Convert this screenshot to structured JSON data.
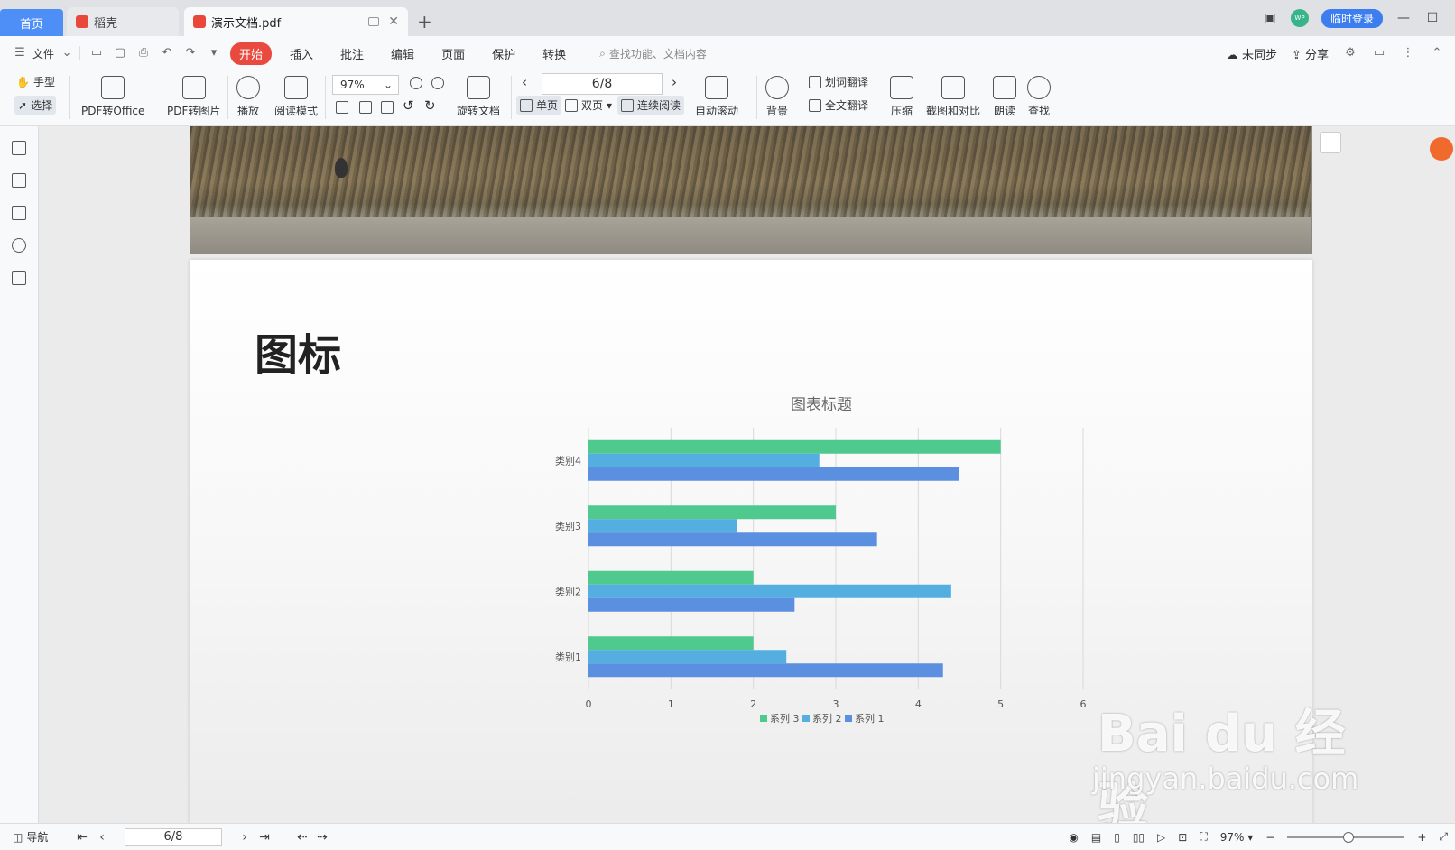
{
  "tabs": {
    "home": "首页",
    "daoke": "稻壳",
    "doc": "演示文档.pdf",
    "add": "+"
  },
  "titlebar": {
    "login": "临时登录",
    "avatar_text": "WP"
  },
  "menu": {
    "file": "文件",
    "tabs": [
      "开始",
      "插入",
      "批注",
      "编辑",
      "页面",
      "保护",
      "转换"
    ],
    "search_placeholder": "查找功能、文档内容",
    "sync": "未同步",
    "share": "分享"
  },
  "toolbar": {
    "hand": "手型",
    "select": "选择",
    "pdf_to_office": "PDF转Office",
    "pdf_to_image": "PDF转图片",
    "play": "播放",
    "read_mode": "阅读模式",
    "zoom": "97%",
    "rotate_doc": "旋转文档",
    "page_indicator": "6/8",
    "single_page": "单页",
    "double_page": "双页",
    "continuous": "连续阅读",
    "auto_scroll": "自动滚动",
    "background": "背景",
    "word_translate": "划词翻译",
    "full_translate": "全文翻译",
    "compress": "压缩",
    "screenshot_compare": "截图和对比",
    "read_aloud": "朗读",
    "find": "查找"
  },
  "page": {
    "heading": "图标"
  },
  "chart_data": {
    "type": "bar",
    "orientation": "horizontal",
    "title": "图表标题",
    "categories": [
      "类别1",
      "类别2",
      "类别3",
      "类别4"
    ],
    "series": [
      {
        "name": "系列 1",
        "values": [
          4.3,
          2.5,
          3.5,
          4.5
        ],
        "color": "#5b8fe0"
      },
      {
        "name": "系列 2",
        "values": [
          2.4,
          4.4,
          1.8,
          2.8
        ],
        "color": "#55aee0"
      },
      {
        "name": "系列 3",
        "values": [
          2.0,
          2.0,
          3.0,
          5.0
        ],
        "color": "#4fc98e"
      }
    ],
    "legend_order": [
      "系列 3",
      "系列 2",
      "系列 1"
    ],
    "xlim": [
      0,
      6
    ],
    "xticks": [
      "0",
      "1",
      "2",
      "3",
      "4",
      "5",
      "6"
    ],
    "grid": true,
    "legend_position": "bottom"
  },
  "watermark": {
    "brand": "Bai du 经验",
    "url": "jingyan.baidu.com"
  },
  "statusbar": {
    "nav": "导航",
    "page_indicator": "6/8",
    "zoom": "97%"
  }
}
